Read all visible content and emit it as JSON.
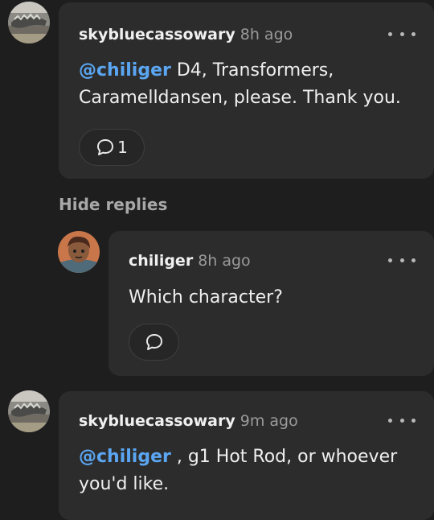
{
  "comments": [
    {
      "username": "skybluecassowary",
      "time": "8h ago",
      "mention": "@chiliger",
      "text": " D4, Transformers, Caramelldansen, please. Thank you.",
      "reply_count": "1"
    },
    {
      "username": "chiliger",
      "time": "8h ago",
      "text": "Which character?"
    },
    {
      "username": "skybluecassowary",
      "time": "9m ago",
      "mention": "@chiliger",
      "text": " , g1 Hot Rod, or whoever you'd like."
    }
  ],
  "hide_replies_label": "Hide replies",
  "colors": {
    "background": "#1e1e1e",
    "card": "#2c2c2c",
    "mention": "#5ba6f2",
    "timestamp": "#9a9a9a"
  },
  "icons": {
    "reply": "speech-bubble-icon",
    "more": "more-options-icon"
  }
}
